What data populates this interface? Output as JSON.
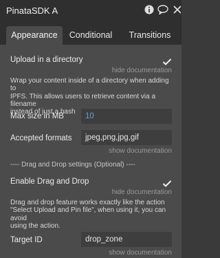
{
  "header": {
    "title": "PinataSDK A",
    "icons": [
      "info-icon",
      "comment-icon",
      "close-icon"
    ]
  },
  "tabs": [
    {
      "label": "Appearance",
      "active": true
    },
    {
      "label": "Conditional",
      "active": false
    },
    {
      "label": "Transitions",
      "active": false
    }
  ],
  "upload_dir": {
    "label": "Upload in a directory",
    "checked": true,
    "hide_doc": "hide documentation",
    "doc_lines": [
      "Wrap your content inside of a directory when adding to",
      "IPFS. This allows users to retrieve content via a filename",
      "instead of just a hash"
    ]
  },
  "max_size": {
    "label": "Max size in MB",
    "value": "10"
  },
  "accepted_formats": {
    "label": "Accepted formats",
    "value": "jpeg,png,jpg,gif",
    "show_doc": "show documentation"
  },
  "dnd_section": {
    "title": "---- Drag and Drop settings (Optional) ----"
  },
  "enable_dnd": {
    "label": "Enable Drag and Drop",
    "checked": true,
    "hide_doc": "hide documentation",
    "doc_lines": [
      "Drag and drop feature works exactly like the action",
      "\"Select Upload and Pin file\", when using it, you can avoid",
      "using the action."
    ]
  },
  "target_id": {
    "label": "Target ID",
    "value": "drop_zone",
    "show_doc": "show documentation"
  },
  "colors": {
    "panel": "#4b4b4b",
    "header": "#2f2f2f",
    "field": "#3e3e3e",
    "number": "#6f9bd6"
  }
}
